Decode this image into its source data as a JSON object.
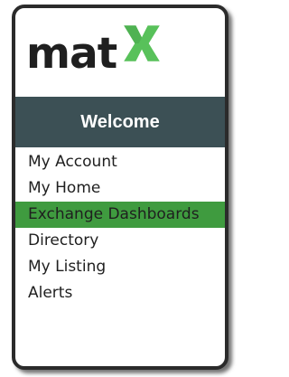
{
  "brand": {
    "wordmark": "mat",
    "logo_icon": "green-x-icon",
    "accent_color": "#58c15a"
  },
  "header": {
    "title": "Welcome",
    "background": "#3c5055"
  },
  "menu": {
    "items": [
      {
        "label": "My Account"
      },
      {
        "label": "My Home"
      },
      {
        "label": "Exchange Dashboards",
        "active": true
      },
      {
        "label": "Directory"
      },
      {
        "label": "My Listing"
      },
      {
        "label": "Alerts"
      }
    ],
    "active_color": "#3f9b3f"
  }
}
